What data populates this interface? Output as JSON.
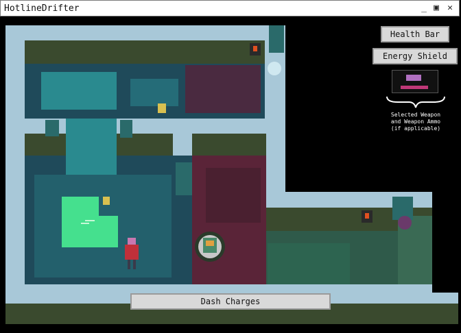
{
  "window": {
    "title": "HotlineDrifter",
    "minimize_glyph": "_",
    "maximize_glyph": "▣",
    "close_glyph": "✕"
  },
  "hud": {
    "health_label": "Health Bar",
    "shield_label": "Energy Shield",
    "dash_label": "Dash Charges",
    "weapon_caption": [
      "Selected Weapon",
      "and Weapon Ammo",
      "(if applicable)"
    ]
  },
  "colors": {
    "water_deep": "#1f4a5a",
    "water_teal": "#2a8a8f",
    "wall_ice": "#a8c8d8",
    "grass_band": "#3a4a2e",
    "toxic_pool": "#45e08e",
    "floor_maroon": "#5a2438",
    "hud_button_bg": "#d9d9d9",
    "player_coat": "#c0303a"
  },
  "icons": {
    "torch": "torch-icon",
    "portal": "portal-icon",
    "weapon": "weapon-icon"
  }
}
